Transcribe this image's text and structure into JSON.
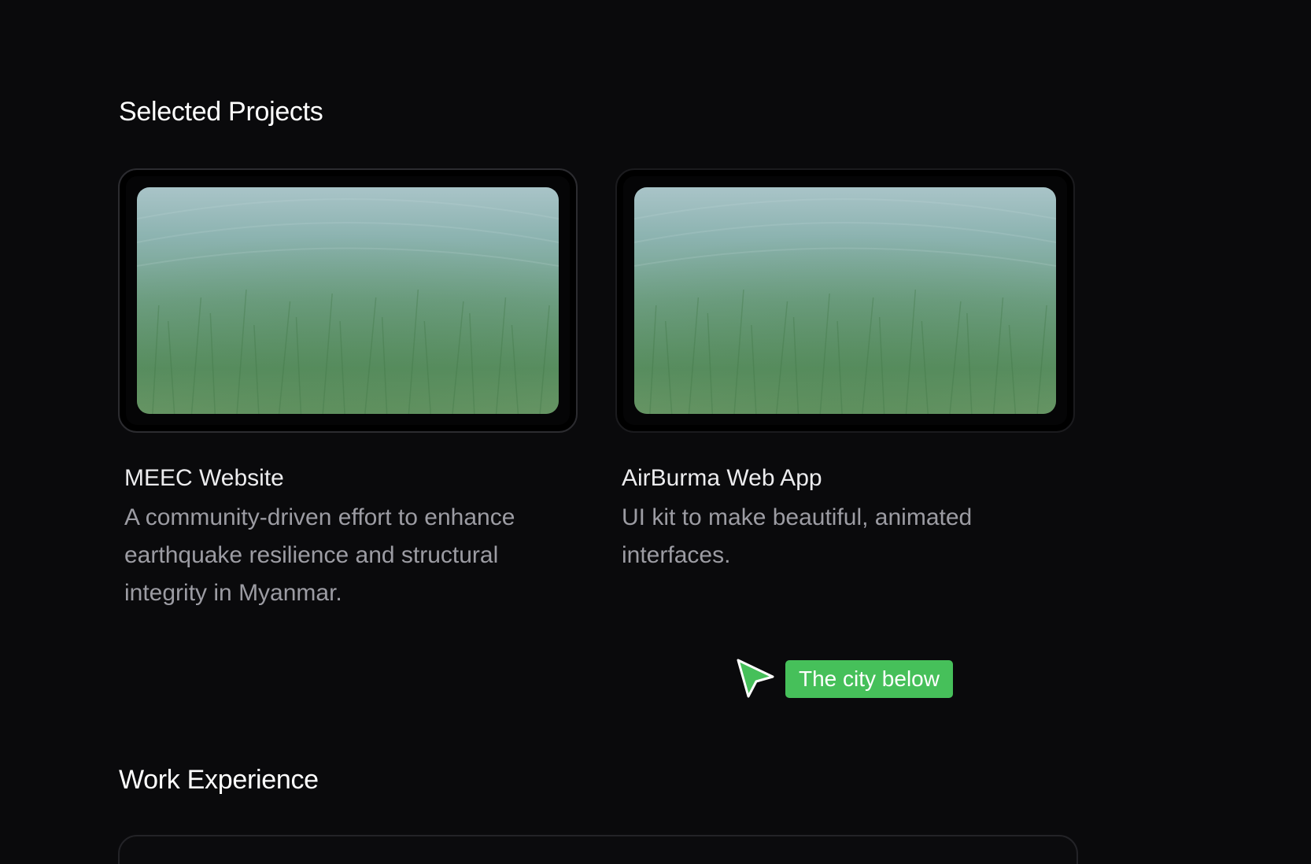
{
  "sections": {
    "projects_title": "Selected Projects",
    "work_title": "Work Experience"
  },
  "projects": [
    {
      "name": "MEEC Website",
      "description": "A community-driven effort to enhance earthquake resilience and structural integrity in Myanmar.",
      "thumbnail_icon": "underwater-seagrass-image"
    },
    {
      "name": "AirBurma Web App",
      "description": "UI kit to make beautiful, animated interfaces.",
      "thumbnail_icon": "underwater-seagrass-image"
    }
  ],
  "cursor": {
    "icon": "cursor-arrow-icon",
    "label": "The city below",
    "color": "#46c05a"
  },
  "colors": {
    "background": "#0a0a0c",
    "card_border": "#2c2c30",
    "muted_text": "#9c9ca3"
  }
}
